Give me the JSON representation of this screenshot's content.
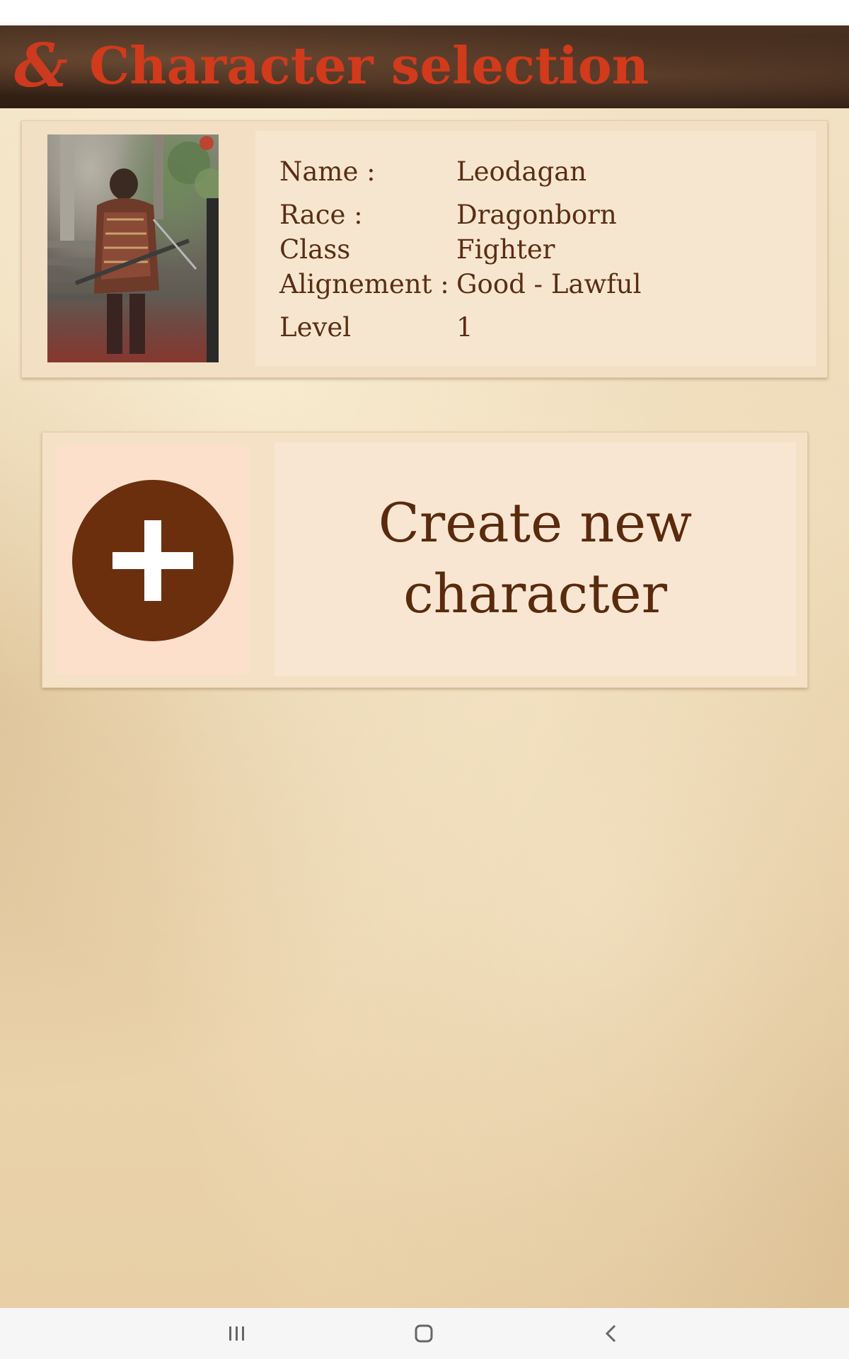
{
  "header": {
    "title": "Character selection",
    "logo_glyph": "&"
  },
  "character": {
    "rows": [
      {
        "label": "Name :",
        "value": "Leodagan"
      },
      {
        "label": "Race :",
        "value": "Dragonborn"
      },
      {
        "label": "Class",
        "value": "Fighter"
      },
      {
        "label": "Alignement :",
        "value": "Good - Lawful"
      },
      {
        "label": "Level",
        "value": "1"
      }
    ]
  },
  "create": {
    "line1": "Create new",
    "line2": "character"
  },
  "colors": {
    "accent": "#d13a1b",
    "brown": "#6b2f0d",
    "text": "#5a2d14"
  },
  "icons": {
    "logo": "dnd-ampersand-logo-icon",
    "plus": "plus-circle-icon",
    "recents": "recents-icon",
    "home": "home-icon",
    "back": "back-icon"
  }
}
